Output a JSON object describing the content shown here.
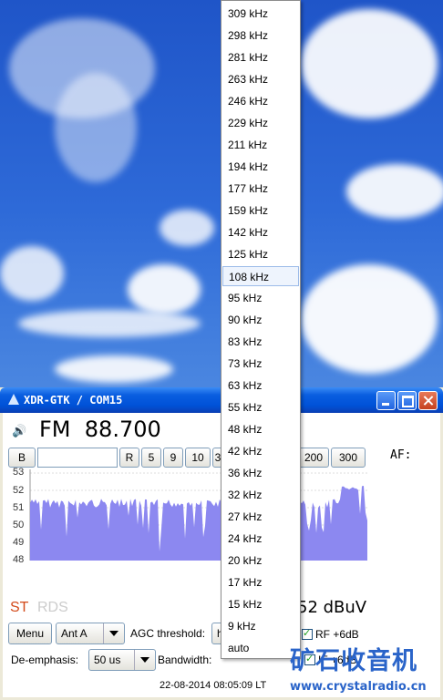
{
  "window": {
    "title": "XDR-GTK / COM15",
    "mode": "FM",
    "frequency": "88.700"
  },
  "toolbar": {
    "b_label": "B",
    "r_label": "R",
    "bw_buttons": [
      "5",
      "9",
      "10",
      "3",
      "200",
      "300"
    ],
    "af_label": "AF:"
  },
  "graph": {
    "ytick_labels": [
      "53",
      "52",
      "51",
      "50",
      "49",
      "48"
    ],
    "fill_color": "#8c88f0"
  },
  "indicators": {
    "st": "ST",
    "rds": "RDS",
    "signal": "52 dBuV"
  },
  "controls": {
    "menu_label": "Menu",
    "antenna_value": "Ant A",
    "agc_label": "AGC threshold:",
    "agc_value_partial": "h",
    "rf_label": "RF +6dB",
    "deemphasis_label": "De-emphasis:",
    "deemphasis_value": "50 us",
    "bandwidth_label": "Bandwidth:",
    "if_label": "IF +6dB"
  },
  "status_bar": {
    "timestamp": "22-08-2014 08:05:09 LT"
  },
  "bandwidth_dropdown": {
    "options": [
      "309 kHz",
      "298 kHz",
      "281 kHz",
      "263 kHz",
      "246 kHz",
      "229 kHz",
      "211 kHz",
      "194 kHz",
      "177 kHz",
      "159 kHz",
      "142 kHz",
      "125 kHz",
      "108 kHz",
      "95 kHz",
      "90 kHz",
      "83 kHz",
      "73 kHz",
      "63 kHz",
      "55 kHz",
      "48 kHz",
      "42 kHz",
      "36 kHz",
      "32 kHz",
      "27 kHz",
      "24 kHz",
      "20 kHz",
      "17 kHz",
      "15 kHz",
      "9 kHz",
      "auto"
    ],
    "highlighted": "108 kHz"
  },
  "watermark": {
    "text": "矿石收音机",
    "url": "www.crystalradio.cn"
  },
  "colors": {
    "title_bar": "#0a5ee0",
    "st_indicator": "#d34a1a",
    "watermark": "#2a64c9"
  }
}
